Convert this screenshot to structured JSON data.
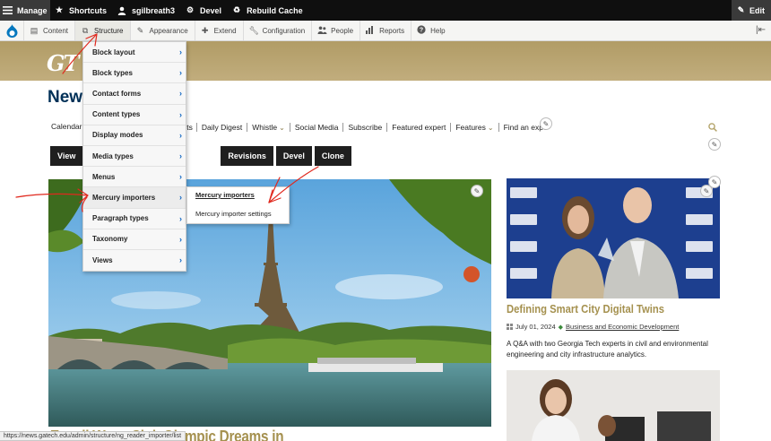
{
  "toolbar": {
    "manage": "Manage",
    "shortcuts": "Shortcuts",
    "user": "sgilbreath3",
    "devel": "Devel",
    "rebuild_cache": "Rebuild Cache",
    "edit": "Edit"
  },
  "tray": {
    "items": [
      {
        "label": "Content",
        "icon": "file-icon"
      },
      {
        "label": "Structure",
        "icon": "structure-icon"
      },
      {
        "label": "Appearance",
        "icon": "brush-icon"
      },
      {
        "label": "Extend",
        "icon": "puzzle-icon"
      },
      {
        "label": "Configuration",
        "icon": "wrench-icon"
      },
      {
        "label": "People",
        "icon": "people-icon"
      },
      {
        "label": "Reports",
        "icon": "reports-icon"
      },
      {
        "label": "Help",
        "icon": "help-icon"
      }
    ]
  },
  "site": {
    "logo_text": "GT",
    "page_title": "News"
  },
  "nav": {
    "calendar": "Calendar",
    "items": [
      "Daily Digest",
      "Whistle",
      "Social Media",
      "Subscribe",
      "Featured expert",
      "Features",
      "Find an expe"
    ],
    "partial_before": "cts"
  },
  "tabs": [
    "View",
    "Revisions",
    "Devel",
    "Clone"
  ],
  "structure_menu": {
    "items": [
      "Block layout",
      "Block types",
      "Contact forms",
      "Content types",
      "Display modes",
      "Media types",
      "Menus",
      "Mercury importers",
      "Paragraph types",
      "Taxonomy",
      "Views"
    ],
    "hovered": "Mercury importers",
    "submenu": [
      "Mercury importers",
      "Mercury importer settings"
    ]
  },
  "hero": {
    "headline": "E. coli Woes Sink Olympic Dreams in"
  },
  "side_story": {
    "title": "Defining Smart City Digital Twins",
    "date": "July 01, 2024",
    "category": "Business and Economic Development",
    "description": "A Q&A with two Georgia Tech experts in civil and environmental engineering and city infrastructure analytics."
  },
  "status_url": "https://news.gatech.edu/admin/structure/ng_reader_importer/list",
  "colors": {
    "gt_gold": "#b3a369",
    "gt_navy": "#003057",
    "annotation_red": "#e0281d",
    "submenu_arrow": "#0b63c1"
  }
}
